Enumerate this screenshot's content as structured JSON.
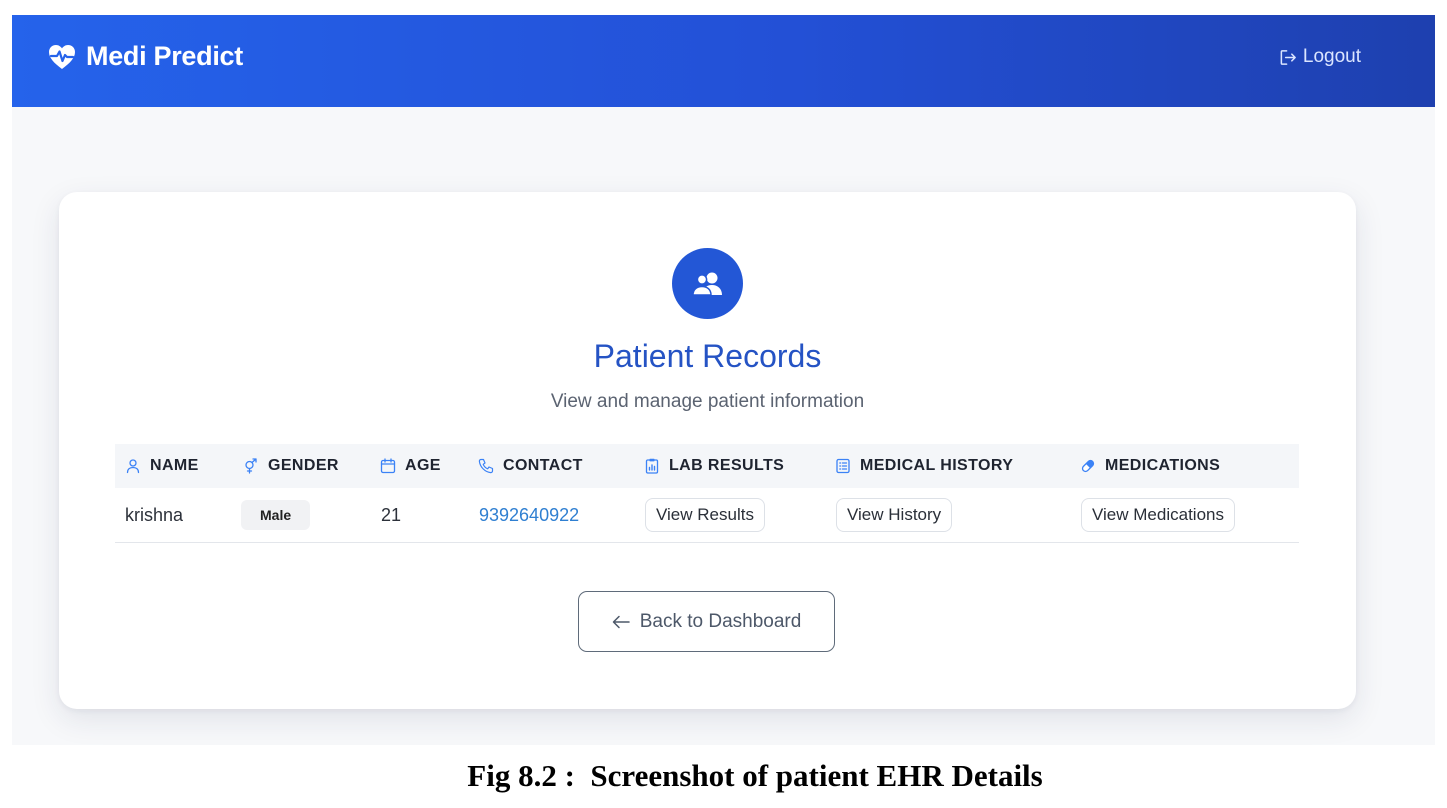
{
  "app": {
    "brand": "Medi Predict",
    "brand_icon": "heart-pulse-icon",
    "logout_label": "Logout",
    "logout_icon": "logout-icon"
  },
  "header": {
    "icon": "users-icon",
    "title": "Patient Records",
    "subtitle": "View and manage patient information"
  },
  "table": {
    "columns": [
      {
        "label": "NAME",
        "icon": "user-icon"
      },
      {
        "label": "GENDER",
        "icon": "gender-icon"
      },
      {
        "label": "AGE",
        "icon": "calendar-icon"
      },
      {
        "label": "CONTACT",
        "icon": "phone-icon"
      },
      {
        "label": "LAB RESULTS",
        "icon": "lab-report-icon"
      },
      {
        "label": "MEDICAL HISTORY",
        "icon": "list-document-icon"
      },
      {
        "label": "MEDICATIONS",
        "icon": "pill-icon"
      }
    ],
    "rows": [
      {
        "name": "krishna",
        "gender": "Male",
        "age": "21",
        "contact": "9392640922",
        "lab_results": "View Results",
        "medical_history": "View History",
        "medications": "View Medications"
      }
    ]
  },
  "back_button": {
    "label": "Back to Dashboard",
    "icon": "arrow-left-icon"
  },
  "caption": "Fig 8.2 :  Screenshot of patient EHR Details",
  "colors": {
    "primary": "#2563eb",
    "primary_dark": "#1e40af",
    "title": "#2553c4",
    "link": "#2f7fd1",
    "icon": "#3b82f6"
  }
}
